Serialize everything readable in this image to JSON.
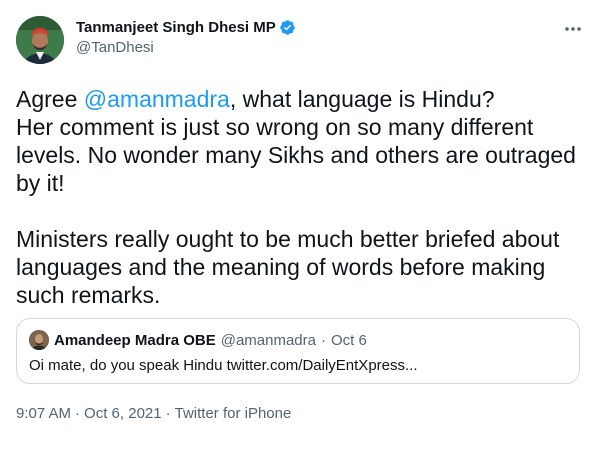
{
  "author": {
    "display_name": "Tanmanjeet Singh Dhesi MP",
    "handle": "@TanDhesi",
    "verified_icon": "verified-badge-icon"
  },
  "tweet": {
    "text_parts": {
      "prefix": "Agree ",
      "mention": "@amanmadra",
      "suffix": ", what language is Hindu?\nHer comment is just so wrong on so many different levels. No wonder many Sikhs and others are outraged by it!\n\nMinisters really ought to be much better briefed about languages and the meaning of words before making such remarks."
    }
  },
  "quote": {
    "display_name": "Amandeep Madra OBE",
    "handle": "@amanmadra",
    "separator": "·",
    "date": "Oct 6",
    "text": "Oi mate, do you speak Hindu twitter.com/DailyEntXpress..."
  },
  "meta": {
    "time": "9:07 AM",
    "separator1": "·",
    "date": "Oct 6, 2021",
    "separator2": "·",
    "source": "Twitter for iPhone"
  },
  "colors": {
    "link": "#1d9bf0",
    "secondary_text": "#536471",
    "border": "#cfd9de"
  },
  "icons": {
    "more": "more-horizontal-icon"
  }
}
